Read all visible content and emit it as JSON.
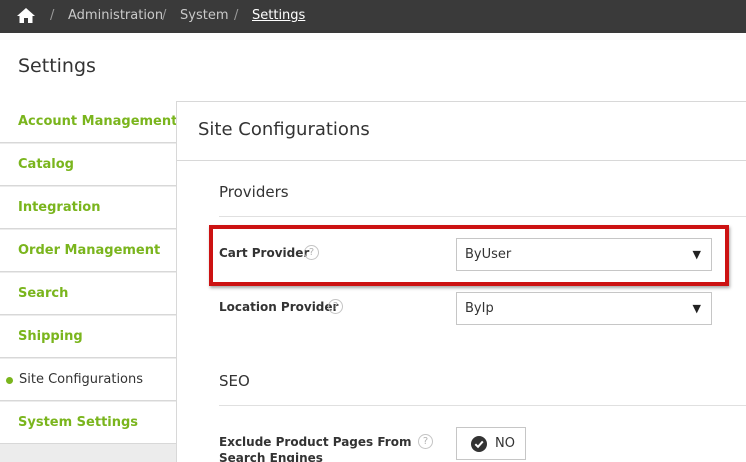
{
  "breadcrumb": {
    "home_icon": "home-icon",
    "separator": "/",
    "items": [
      "Administration",
      "System",
      "Settings"
    ]
  },
  "page": {
    "title": "Settings"
  },
  "sidebar": {
    "items": [
      {
        "label": "Account Management"
      },
      {
        "label": "Catalog"
      },
      {
        "label": "Integration"
      },
      {
        "label": "Order Management"
      },
      {
        "label": "Search"
      },
      {
        "label": "Shipping"
      },
      {
        "label": "Site Configurations",
        "active": true
      },
      {
        "label": "System Settings"
      }
    ]
  },
  "main": {
    "section_title": "Site Configurations",
    "groups": [
      {
        "title": "Providers",
        "fields": [
          {
            "label": "Cart Provider",
            "help": "?",
            "value": "ByUser"
          },
          {
            "label": "Location Provider",
            "help": "?",
            "value": "ByIp"
          }
        ]
      },
      {
        "title": "SEO",
        "fields": [
          {
            "label_line1": "Exclude Product Pages From",
            "label_line2": "Search Engines",
            "help": "?",
            "value": "NO"
          }
        ]
      }
    ]
  },
  "select_arrow": "▼",
  "colors": {
    "accent": "#7ab51d",
    "highlight": "#cc1212",
    "topbar": "#3a3a3a"
  }
}
